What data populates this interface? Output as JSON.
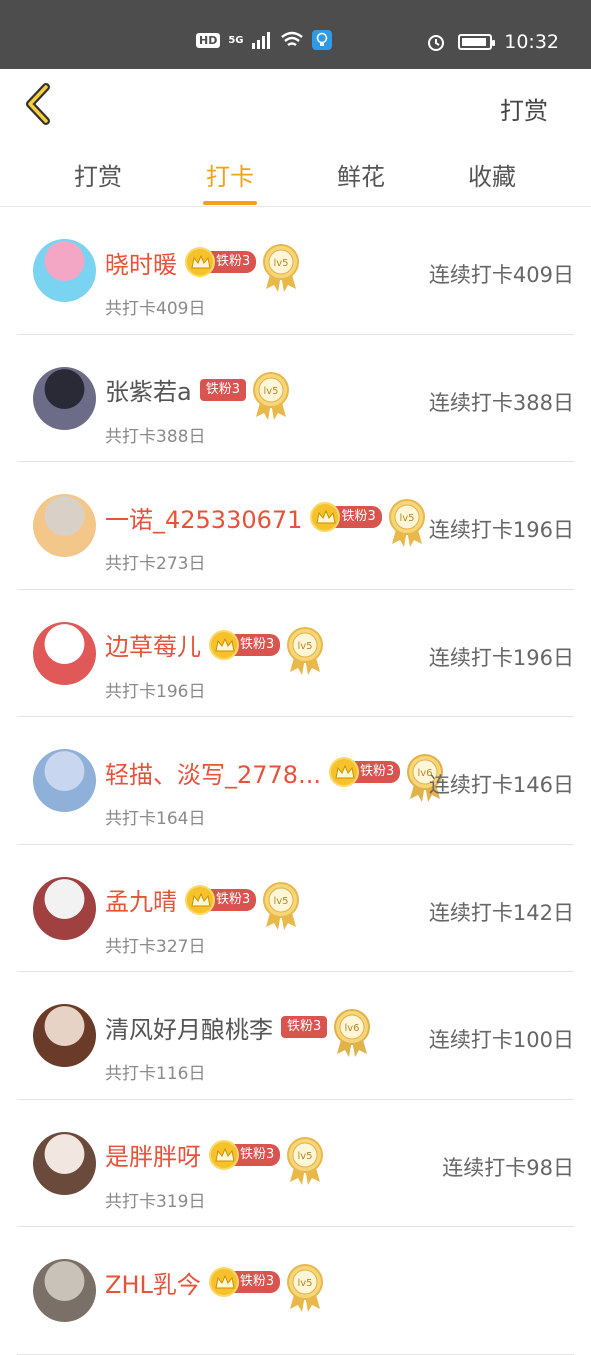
{
  "status_bar": {
    "hd": "HD",
    "net": "5G",
    "time": "10:32"
  },
  "header": {
    "right_label": "打赏"
  },
  "tabs": [
    {
      "label": "打赏"
    },
    {
      "label": "打卡"
    },
    {
      "label": "鲜花"
    },
    {
      "label": "收藏"
    }
  ],
  "active_tab": "打卡",
  "rows": [
    {
      "name": "晓时暖",
      "vip": true,
      "fan": "铁粉3",
      "level": "lv5",
      "total": "共打卡409日",
      "streak": "连续打卡409日"
    },
    {
      "name": "张紫若a",
      "vip": false,
      "fan": "铁粉3",
      "level": "lv5",
      "total": "共打卡388日",
      "streak": "连续打卡388日"
    },
    {
      "name": "一诺_425330671",
      "vip": true,
      "fan": "铁粉3",
      "level": "lv5",
      "total": "共打卡273日",
      "streak": "连续打卡196日"
    },
    {
      "name": "边草莓儿",
      "vip": true,
      "fan": "铁粉3",
      "level": "lv5",
      "total": "共打卡196日",
      "streak": "连续打卡196日"
    },
    {
      "name": "轻描、淡写_2778...",
      "vip": true,
      "fan": "铁粉3",
      "level": "lv6",
      "total": "共打卡164日",
      "streak": "连续打卡146日"
    },
    {
      "name": "孟九晴",
      "vip": true,
      "fan": "铁粉3",
      "level": "lv5",
      "total": "共打卡327日",
      "streak": "连续打卡142日"
    },
    {
      "name": "清风好月酿桃李",
      "vip": false,
      "fan": "铁粉3",
      "level": "lv6",
      "total": "共打卡116日",
      "streak": "连续打卡100日"
    },
    {
      "name": "是胖胖呀",
      "vip": true,
      "fan": "铁粉3",
      "level": "lv5",
      "total": "共打卡319日",
      "streak": "连续打卡98日"
    },
    {
      "name": "ZHL乳今",
      "vip": true,
      "fan": "铁粉3",
      "level": "lv5",
      "total": "",
      "streak": ""
    }
  ],
  "colors": {
    "accent": "#f0a31a",
    "vip_name": "#e5533a",
    "fan_badge": "#d9534f",
    "status_bar": "#4d4d4d"
  }
}
